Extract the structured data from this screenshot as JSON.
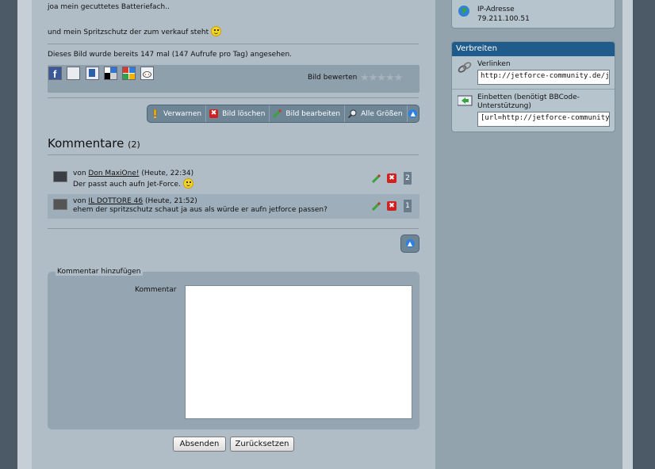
{
  "post": {
    "line1": "joa mein gecuttetes Batteriefach..",
    "line2": "und mein Spritzschutz der zum verkauf steht",
    "views": "Dieses Bild wurde bereits 147 mal (147 Aufrufe pro Tag) angesehen."
  },
  "share": {
    "icons": [
      "facebook-icon",
      "myspace-icon",
      "studivz-icon",
      "delicious-icon",
      "google-icon",
      "reddit-icon"
    ],
    "rating_label": "Bild bewerten",
    "stars": "★★★★★",
    "rating_value": 0
  },
  "toolbar": {
    "warn": "Verwarnen",
    "delete": "Bild löschen",
    "edit": "Bild bearbeiten",
    "sizes": "Alle Größen",
    "up": "▲"
  },
  "comments": {
    "title": "Kommentare",
    "count": "(2)",
    "items": [
      {
        "prefix": "von",
        "author": "Don MaxiOne!",
        "time": "(Heute, 22:34)",
        "text": "Der passt auch aufn Jet-Force.",
        "number": "2"
      },
      {
        "prefix": "von",
        "author": "IL DOTTORE 46",
        "time": "(Heute, 21:52)",
        "text": "ehem der spritzschutz schaut ja aus als würde er aufn jetforce passen?",
        "number": "1"
      }
    ],
    "delete_glyph": "✖"
  },
  "form": {
    "legend": "Kommentar hinzufügen",
    "label": "Kommentar",
    "submit": "Absenden",
    "reset": "Zurücksetzen"
  },
  "sidebar": {
    "ip_label": "IP-Adresse",
    "ip_value": "79.211.100.51",
    "share_title": "Verbreiten",
    "link_label": "Verlinken",
    "link_value": "http://jetforce-community.de/jetforce",
    "embed_label1": "Einbetten (benötigt BBCode-",
    "embed_label2": "Unterstützung)",
    "embed_value": "[url=http://jetforce-community.de/jetforce"
  },
  "colors": {
    "sidebar_header": "#1f5c8c",
    "toolbar": "#6d8595",
    "delete_red": "#d02020"
  }
}
